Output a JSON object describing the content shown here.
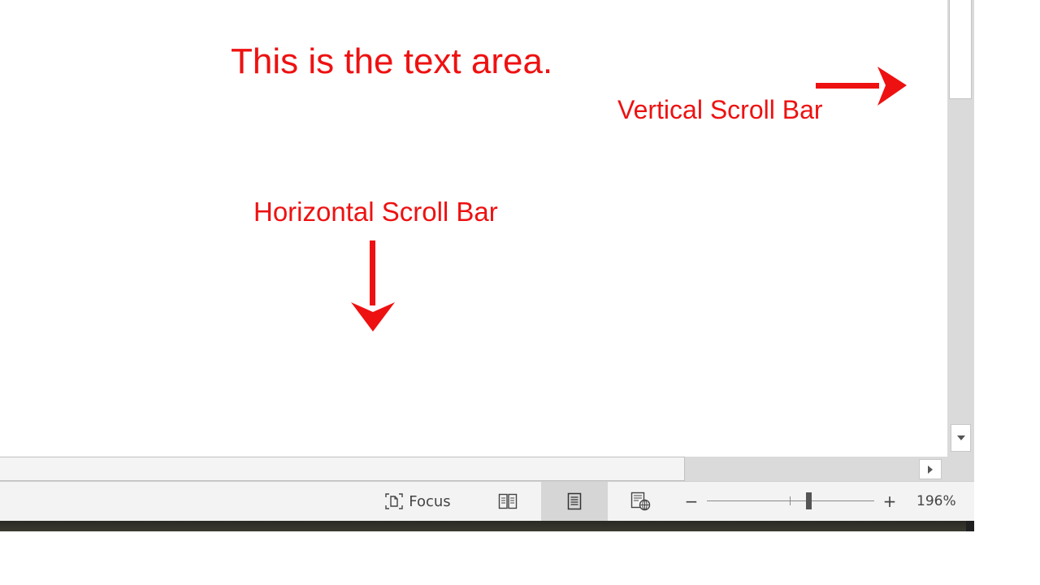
{
  "document": {
    "annotations": {
      "text_area": "This is the text area.",
      "vertical_scroll_bar": "Vertical Scroll Bar",
      "horizontal_scroll_bar": "Horizontal Scroll Bar"
    },
    "annotation_color": "#ee1111"
  },
  "statusbar": {
    "focus_label": "Focus",
    "zoom_level": "196%",
    "zoom_out_symbol": "−",
    "zoom_in_symbol": "+",
    "view_modes": [
      "read-mode",
      "print-layout",
      "web-layout"
    ],
    "active_view": "print-layout"
  },
  "icons": {
    "focus": "focus-icon",
    "read_mode": "read-mode-icon",
    "print_layout": "print-layout-icon",
    "web_layout": "web-layout-icon",
    "scroll_down": "triangle-down-icon",
    "scroll_right": "triangle-right-icon"
  }
}
